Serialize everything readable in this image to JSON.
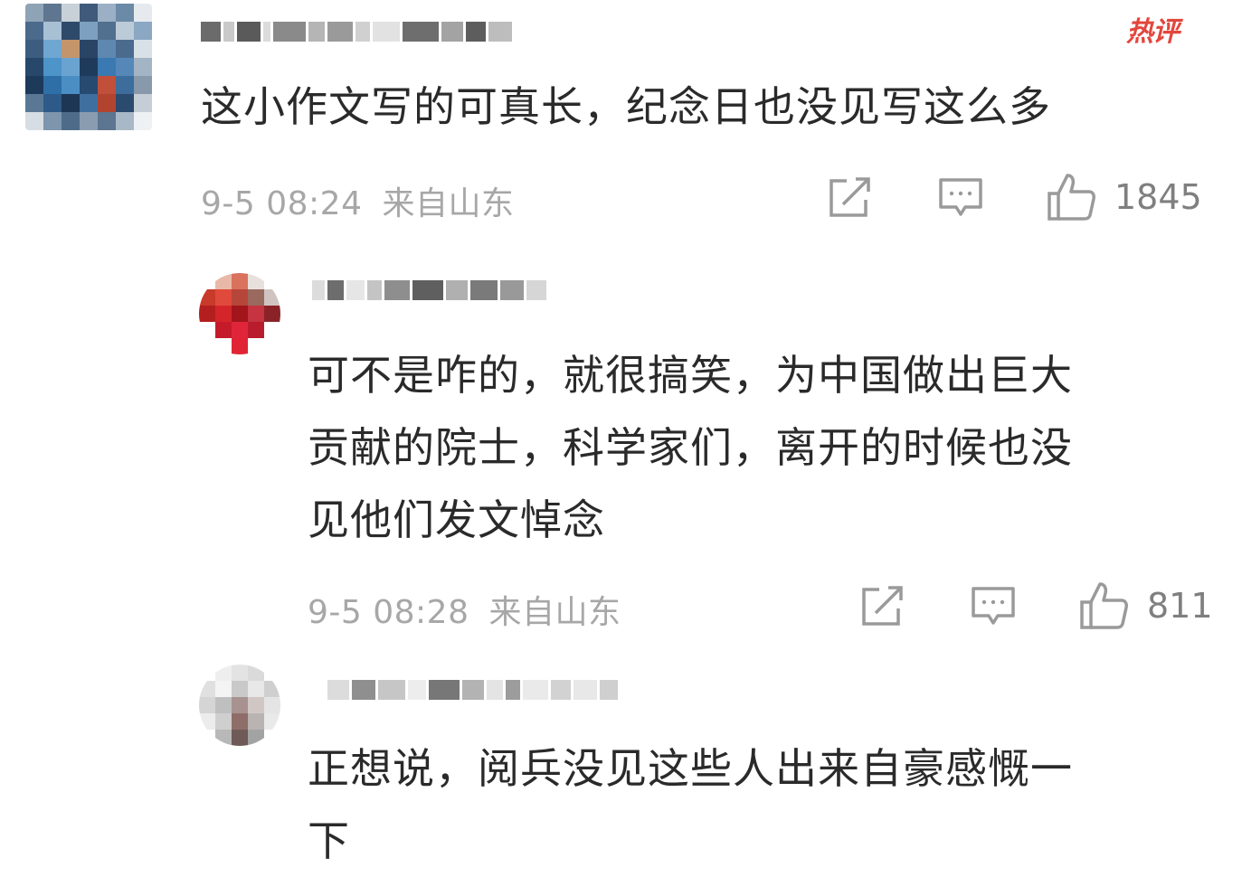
{
  "hot_badge": "热评",
  "comment": {
    "text": "这小作文写的可真长，纪念日也没见写这么多",
    "timestamp": "9-5 08:24",
    "location": "来自山东",
    "likes": "1845"
  },
  "replies": [
    {
      "text_lines": [
        "可不是咋的，就很搞笑，为中国做出巨大",
        "贡献的院士，科学家们，离开的时候也没",
        "见他们发文悼念"
      ],
      "timestamp": "9-5 08:28",
      "location": "来自山东",
      "likes": "811"
    },
    {
      "text_lines": [
        "正想说，阅兵没见这些人出来自豪感慨一",
        "下"
      ]
    }
  ],
  "icons": {
    "share": "share-icon",
    "comment": "comment-icon",
    "like": "thumbs-up-icon"
  },
  "colors": {
    "hot_badge": "#e3463d",
    "text": "#2a2a2a",
    "meta": "#a7a7a7",
    "icon": "#9a9a9a"
  }
}
